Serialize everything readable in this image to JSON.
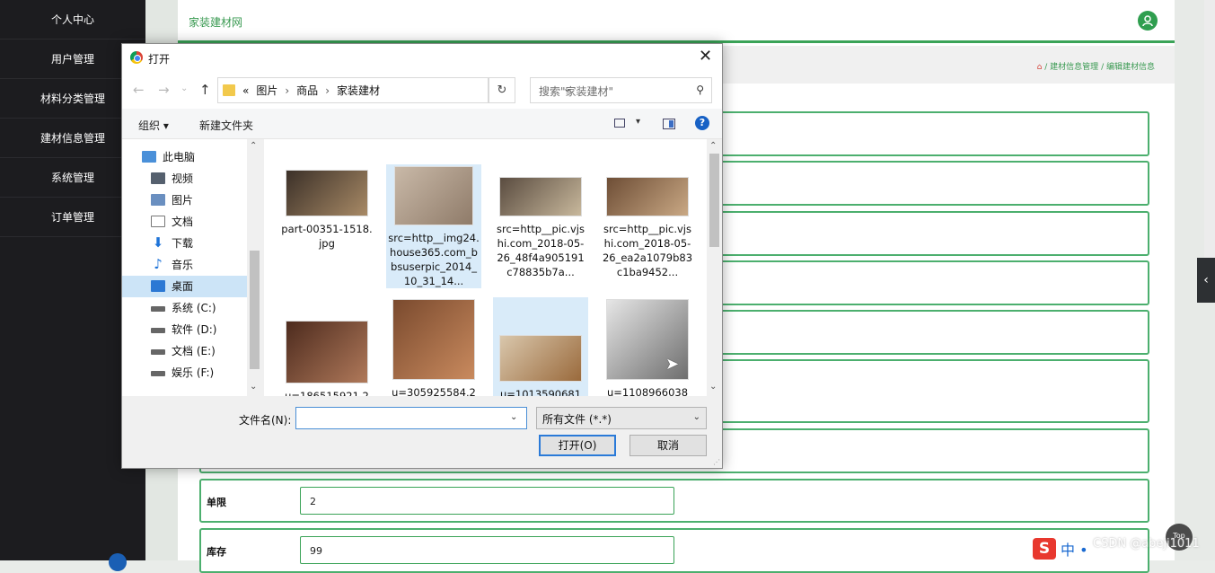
{
  "sidebar": {
    "items": [
      {
        "label": "个人中心"
      },
      {
        "label": "用户管理"
      },
      {
        "label": "材料分类管理"
      },
      {
        "label": "建材信息管理"
      },
      {
        "label": "系统管理"
      },
      {
        "label": "订单管理"
      }
    ]
  },
  "header": {
    "site_title": "家装建材网",
    "breadcrumb": {
      "separator": "/",
      "level1": "建材信息管理",
      "level2": "编辑建材信息"
    }
  },
  "form": {
    "visible_fields": [
      {
        "label": "单限",
        "value": "2"
      },
      {
        "label": "库存",
        "value": "99"
      }
    ]
  },
  "misc": {
    "top_button": "Top",
    "side_toggle": "‹",
    "ime_text": "中 •",
    "watermark": "CSDN @abeji1011"
  },
  "dialog": {
    "title": "打开",
    "close": "✕",
    "nav": {
      "back": "←",
      "forward": "→",
      "recent": "⌄",
      "up": "↑"
    },
    "address": {
      "prefix": "«",
      "crumbs": [
        "图片",
        "商品",
        "家装建材"
      ],
      "separator": "›"
    },
    "search_placeholder": "搜索\"家装建材\"",
    "toolbar": {
      "organize": "组织 ▾",
      "new_folder": "新建文件夹",
      "help": "?"
    },
    "nav_pane": [
      {
        "label": "此电脑",
        "icon": "pc-icon"
      },
      {
        "label": "视频",
        "icon": "video-icon"
      },
      {
        "label": "图片",
        "icon": "pictures-icon"
      },
      {
        "label": "文档",
        "icon": "documents-icon"
      },
      {
        "label": "下载",
        "icon": "download-icon"
      },
      {
        "label": "音乐",
        "icon": "music-icon"
      },
      {
        "label": "桌面",
        "icon": "desktop-icon",
        "selected": true
      },
      {
        "label": "系统 (C:)",
        "icon": "drive-icon"
      },
      {
        "label": "软件 (D:)",
        "icon": "drive-icon"
      },
      {
        "label": "文档 (E:)",
        "icon": "drive-icon"
      },
      {
        "label": "娱乐 (F:)",
        "icon": "drive-icon"
      }
    ],
    "files": [
      {
        "name": "part-00351-1518.jpg",
        "colors": [
          "#3b3028",
          "#a88a66"
        ]
      },
      {
        "name": "src=http__img24.house365.com_bbsuserpic_2014_10_31_14...",
        "colors": [
          "#c9b9a8",
          "#8f7b69"
        ],
        "selected": true
      },
      {
        "name": "src=http__pic.vjshi.com_2018-05-26_48f4a905191c78835b7a...",
        "colors": [
          "#5a4c40",
          "#c8b89c"
        ]
      },
      {
        "name": "src=http__pic.vjshi.com_2018-05-26_ea2a1079b83c1ba9452...",
        "colors": [
          "#6e4e36",
          "#c9a884"
        ]
      },
      {
        "name": "u=186515921,2",
        "colors": [
          "#4d2b1e",
          "#b0795a"
        ]
      },
      {
        "name": "u=305925584,2",
        "colors": [
          "#7a4a2e",
          "#c98a5e"
        ]
      },
      {
        "name": "u=1013590681",
        "colors": [
          "#d9c7ac",
          "#9a6a3c"
        ],
        "selected": true
      },
      {
        "name": "u=1108966038",
        "colors": [
          "#e6e6e6",
          "#6e6e6e"
        ]
      }
    ],
    "filename_label": "文件名(N):",
    "filename_value": "",
    "filetype": "所有文件 (*.*)",
    "open_button": "打开(O)",
    "cancel_button": "取消"
  }
}
